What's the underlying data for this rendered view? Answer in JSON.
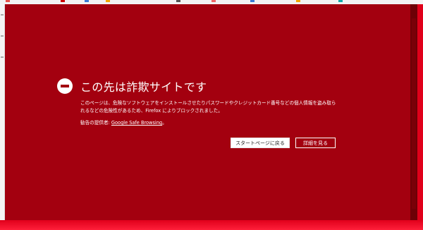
{
  "warning": {
    "title": "この先は詐欺サイトです",
    "description": "このページは、危険なソフトウェアをインストールさせたりパスワードやクレジットカード番号などの個人情報を盗み取られるなどの危険性があるため、Firefox によりブロックされました。",
    "advisory_prefix": "勧告の提供者: ",
    "advisory_link": "Google Safe Browsing",
    "advisory_suffix": "。",
    "back_button": "スタートページに戻る",
    "details_button": "詳細を見る"
  },
  "colors": {
    "page_background": "#a3000f",
    "window_background": "#c8000c",
    "text": "#ffffff"
  },
  "icons": {
    "warning_icon": "blocked-circle-icon"
  }
}
